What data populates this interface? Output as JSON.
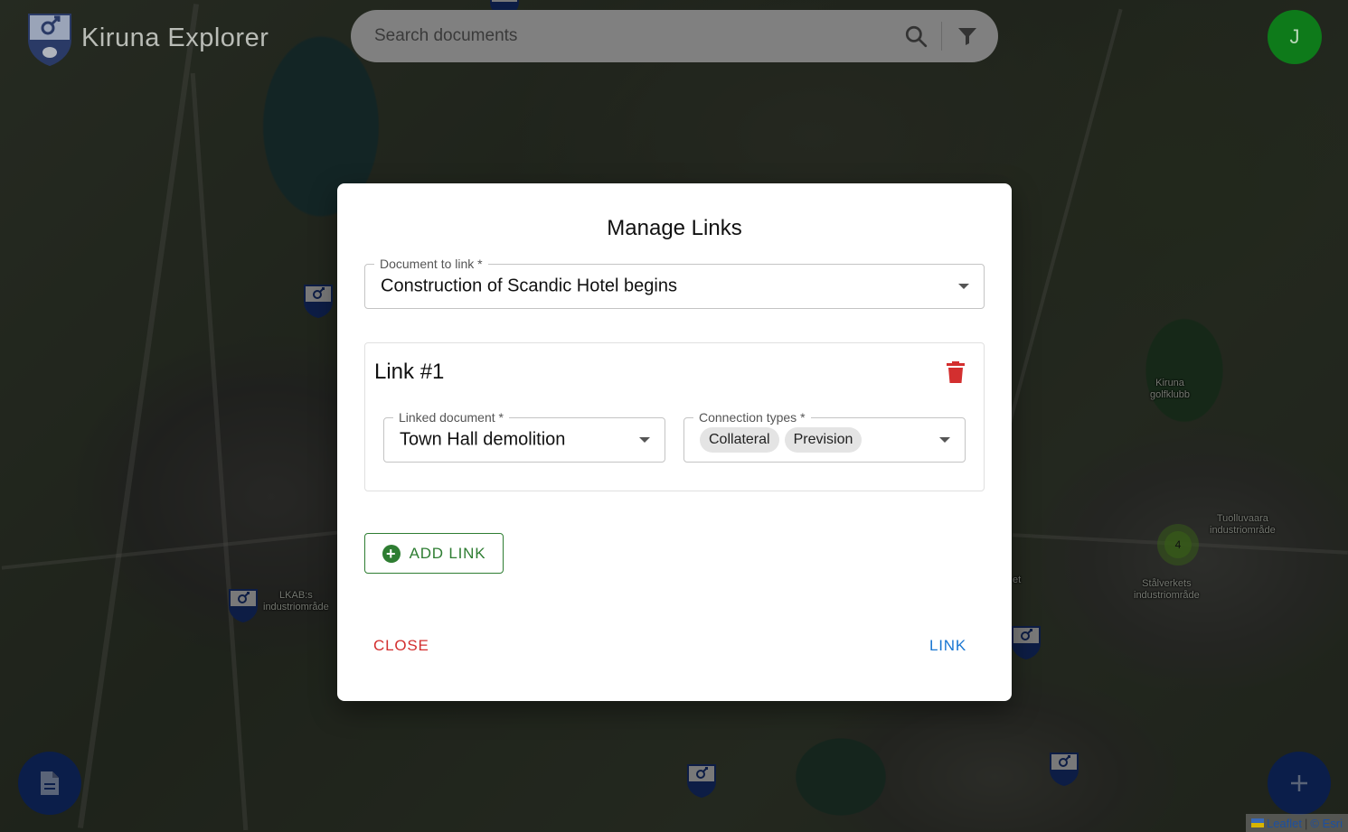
{
  "header": {
    "app_title": "Kiruna Explorer",
    "search_placeholder": "Search documents",
    "avatar_initial": "J"
  },
  "map": {
    "labels": {
      "golf": "Kiruna\ngolfklubb",
      "tuolluvaara": "Tuolluvaara\nindustriområde",
      "stalverkets": "Stålverkets\nindustriområde",
      "lkab": "LKAB:s\nindustriområde",
      "partial": "et"
    },
    "cluster_count": "4",
    "attribution": {
      "leaflet": "Leaflet",
      "separator": "|",
      "esri": "© Esri"
    }
  },
  "modal": {
    "title": "Manage Links",
    "document_field": {
      "label": "Document to link *",
      "value": "Construction of Scandic Hotel begins"
    },
    "links": [
      {
        "title": "Link #1",
        "linked_document_label": "Linked document *",
        "linked_document_value": "Town Hall demolition",
        "connection_types_label": "Connection types *",
        "connection_types": [
          "Collateral",
          "Prevision"
        ]
      }
    ],
    "add_link_label": "ADD LINK",
    "close_label": "CLOSE",
    "link_label": "LINK"
  },
  "colors": {
    "avatar": "#0e7a1a",
    "fab": "#0b1e4a",
    "close": "#d32f2f",
    "link": "#1976d2",
    "add_link": "#2e7d32",
    "delete": "#d32f2f"
  }
}
